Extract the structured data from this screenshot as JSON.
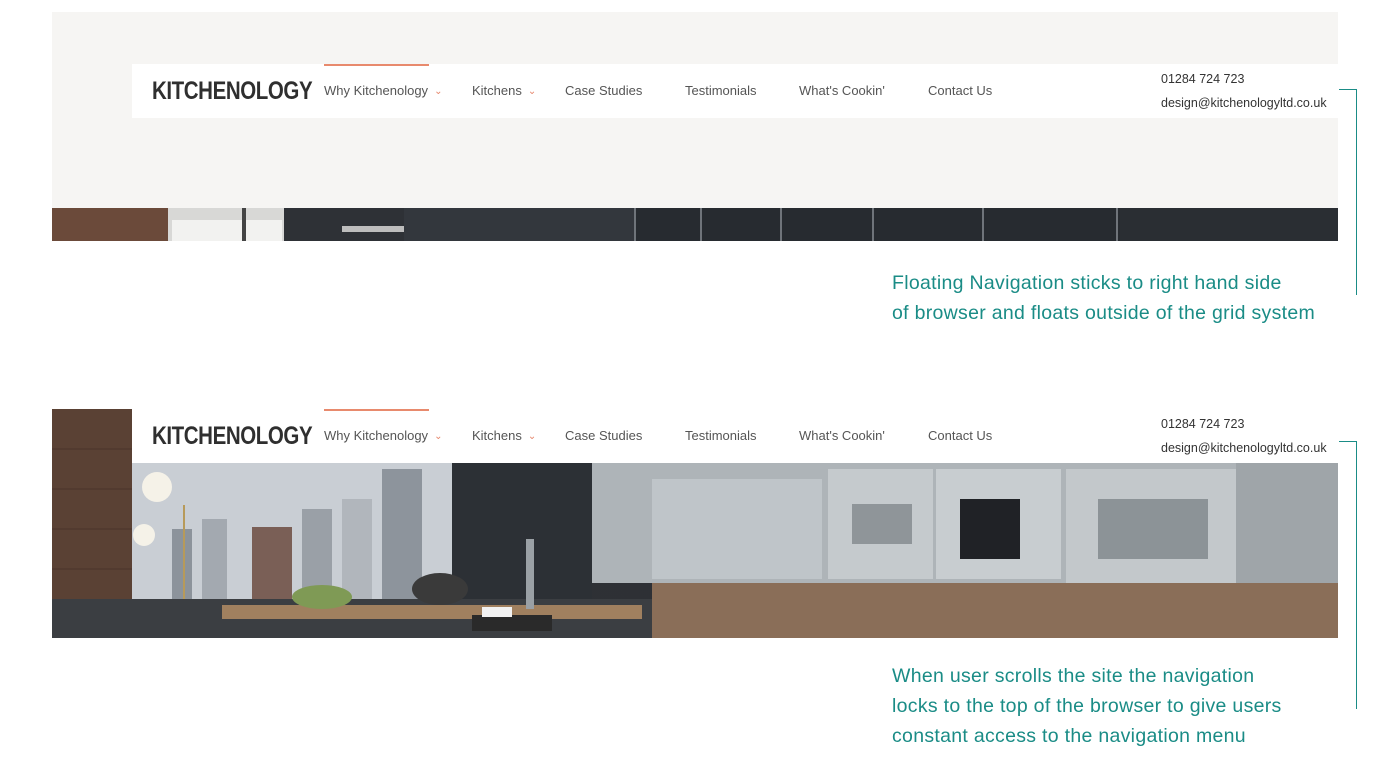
{
  "brand": {
    "logo": "KITCHENOLOGY"
  },
  "nav": {
    "items": [
      {
        "label": "Why Kitchenology",
        "has_dropdown": true,
        "active": true
      },
      {
        "label": "Kitchens",
        "has_dropdown": true,
        "active": false
      },
      {
        "label": "Case Studies",
        "has_dropdown": false,
        "active": false
      },
      {
        "label": "Testimonials",
        "has_dropdown": false,
        "active": false
      },
      {
        "label": "What's Cookin'",
        "has_dropdown": false,
        "active": false
      },
      {
        "label": "Contact Us",
        "has_dropdown": false,
        "active": false
      }
    ],
    "dropdown_icon": "chevron-down-icon"
  },
  "contact": {
    "phone": "01284 724 723",
    "email": "design@kitchenologyltd.co.uk"
  },
  "annotations": {
    "floating": [
      "Floating Navigation sticks to right hand side",
      "of browser and floats outside of the grid system"
    ],
    "sticky": [
      "When user scrolls the site the navigation",
      "locks to the top of the browser to give users",
      "constant access to the navigation menu"
    ]
  },
  "colors": {
    "accent": "#e88a6d",
    "annotation": "#1a8c86",
    "panel_bg": "#f6f5f3"
  }
}
